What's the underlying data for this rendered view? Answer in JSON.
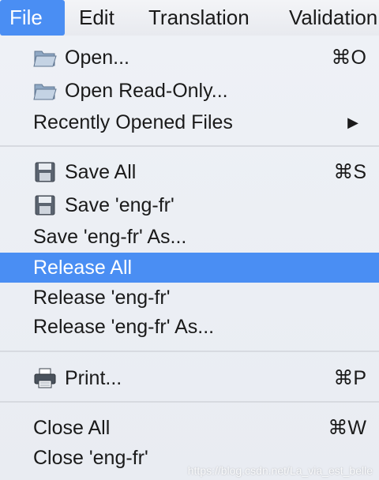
{
  "menubar": {
    "items": [
      {
        "label": "File"
      },
      {
        "label": "Edit"
      },
      {
        "label": "Translation"
      },
      {
        "label": "Validation"
      }
    ]
  },
  "menu": {
    "open": {
      "label": "Open...",
      "shortcut": "⌘O",
      "icon": "folder-icon"
    },
    "open_readonly": {
      "label": "Open Read-Only...",
      "icon": "folder-icon"
    },
    "recent": {
      "label": "Recently Opened Files",
      "arrow": "▶"
    },
    "save_all": {
      "label": "Save All",
      "shortcut": "⌘S",
      "icon": "floppy-disk-icon"
    },
    "save_eng_fr": {
      "label": "Save 'eng-fr'",
      "icon": "floppy-disk-icon"
    },
    "save_eng_fr_as": {
      "label": "Save 'eng-fr' As..."
    },
    "release_all": {
      "label": "Release All"
    },
    "release_eng_fr": {
      "label": "Release 'eng-fr'"
    },
    "release_eng_fr_as": {
      "label": "Release 'eng-fr' As..."
    },
    "print": {
      "label": "Print...",
      "shortcut": "⌘P",
      "icon": "printer-icon"
    },
    "close_all": {
      "label": "Close All",
      "shortcut": "⌘W"
    },
    "close_eng_fr": {
      "label": "Close 'eng-fr'"
    }
  },
  "watermark": "https://blog.csdn.net/La_via_est_belle",
  "colors": {
    "highlight": "#4a8ef3",
    "menu_bg": "#eef1f6",
    "separator": "#d7dae0"
  }
}
